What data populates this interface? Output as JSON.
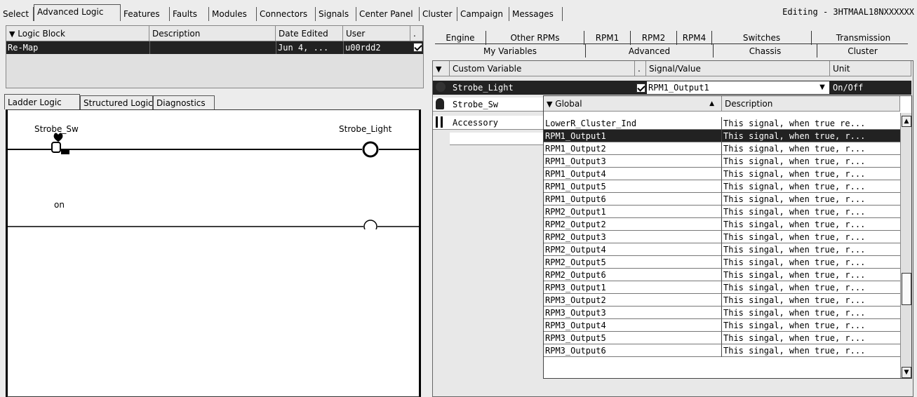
{
  "top_tabs": [
    "Select",
    "Advanced Logic",
    "Features",
    "Faults",
    "Modules",
    "Connectors",
    "Signals",
    "Center Panel",
    "Cluster",
    "Campaign",
    "Messages"
  ],
  "editing_label": "Editing - 3HTMAAL18NXXXXXX",
  "logic_table": {
    "headers": [
      "Logic Block",
      "Description",
      "Date Edited",
      "User",
      "."
    ],
    "row": {
      "logic_block": "Re-Map",
      "description": "",
      "date_edited": "Jun 4, ...",
      "user": "u00rdd2",
      "checked": true
    }
  },
  "left_tabs": [
    "Ladder Logic",
    "Structured Logic",
    "Diagnostics"
  ],
  "ladder": {
    "rung1_input": "Strobe_Sw",
    "rung1_output": "Strobe_Light",
    "rung2_input": "on"
  },
  "right_tabs_back": [
    "Engine",
    "Other RPMs",
    "RPM1",
    "RPM2",
    "RPM4",
    "Switches",
    "Transmission"
  ],
  "right_tabs_front": [
    "My Variables",
    "Advanced",
    "Chassis",
    "Cluster"
  ],
  "variables_table": {
    "headers": [
      "Custom Variable",
      ".",
      "Signal/Value",
      "Unit"
    ],
    "rows": [
      {
        "name": "Strobe_Light",
        "signal": "RPM1_Output1",
        "unit": "On/Off",
        "checked": true
      },
      {
        "name": "Strobe_Sw",
        "signal": "",
        "unit": ""
      },
      {
        "name": "Accessory",
        "signal": "",
        "unit": ""
      }
    ]
  },
  "dropdown": {
    "headers": [
      "Global",
      "Description"
    ],
    "rows": [
      {
        "g": "LowerR_Cluster_Ind",
        "d": "This signal, when true re..."
      },
      {
        "g": "RPM1_Output1",
        "d": "This signal, when true, r...",
        "selected": true
      },
      {
        "g": "RPM1_Output2",
        "d": "This signal, when true, r..."
      },
      {
        "g": "RPM1_Output3",
        "d": "This signal, when true, r..."
      },
      {
        "g": "RPM1_Output4",
        "d": "This signal, when true, r..."
      },
      {
        "g": "RPM1_Output5",
        "d": "This signal, when true, r..."
      },
      {
        "g": "RPM1_Output6",
        "d": "This signal, when true, r..."
      },
      {
        "g": "RPM2_Output1",
        "d": "This singal, when true, r..."
      },
      {
        "g": "RPM2_Output2",
        "d": "This singal, when true, r..."
      },
      {
        "g": "RPM2_Output3",
        "d": "This singal, when true, r..."
      },
      {
        "g": "RPM2_Output4",
        "d": "This singal, when true, r..."
      },
      {
        "g": "RPM2_Output5",
        "d": "This singal, when true, r..."
      },
      {
        "g": "RPM2_Output6",
        "d": "This singal, when true, r..."
      },
      {
        "g": "RPM3_Output1",
        "d": "This singal, when true, r..."
      },
      {
        "g": "RPM3_Output2",
        "d": "This singal, when true, r..."
      },
      {
        "g": "RPM3_Output3",
        "d": "This singal, when true, r..."
      },
      {
        "g": "RPM3_Output4",
        "d": "This singal, when true, r..."
      },
      {
        "g": "RPM3_Output5",
        "d": "This singal, when true, r..."
      },
      {
        "g": "RPM3_Output6",
        "d": "This singal, when true, r..."
      }
    ]
  },
  "icons": [
    "filter-icon",
    "checkbox-icon",
    "sort-up-icon",
    "dropdown-arrow-icon",
    "scroll-up-icon",
    "scroll-down-icon",
    "switch-input-icon",
    "coil-output-icon"
  ]
}
